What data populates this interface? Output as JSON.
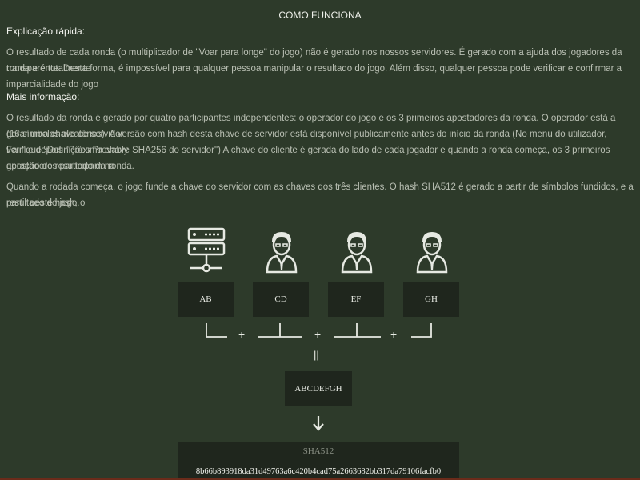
{
  "header": {
    "title": "COMO FUNCIONA"
  },
  "quick": {
    "heading": "Explicação rápida:",
    "line1": "O resultado de cada ronda (o multiplicador de \"Voar para longe\" do jogo) não é gerado nos nossos servidores. É gerado com a ajuda dos jogadores da ronda e é totalmente",
    "line2": "transparente. Desta forma, é impossível para qualquer pessoa manipular o resultado do jogo. Além disso, qualquer pessoa pode verificar e confirmar a imparcialidade do jogo"
  },
  "more": {
    "heading": "Mais informação:",
    "line1": "O resultado da ronda é gerado por quatro participantes independentes: o operador do jogo e os 3 primeiros apostadores da ronda. O operador está a gerar uma chave de servidor",
    "line2": "(16 símbolos aleatórios). A versão com hash desta chave de servidor está disponível publicamente antes do início da ronda (No menu do utilizador, verifique \"Definições Provably",
    "line3": "Fair\" e depois \"Próxima chave SHA256 do servidor\") A chave do cliente é gerada do lado de cada jogador e quando a ronda começa, os 3 primeiros apostadores participam na",
    "line4": "geração do resultado da ronda.",
    "line5": "Quando a rodada começa, o jogo funde a chave do servidor com as chaves dos três clientes. O hash SHA512 é gerado a partir de símbolos fundidos, e a partir deste hash, o",
    "line6": "resultado do jogo."
  },
  "diagram": {
    "icons": [
      "server-icon",
      "player-icon",
      "player-icon",
      "player-icon"
    ],
    "keys": [
      "AB",
      "CD",
      "EF",
      "GH"
    ],
    "plus": "+",
    "equals": "||",
    "combined": "ABCDEFGH",
    "arrow": "↓",
    "sha_label": "SHA512",
    "sha_hash": "8b66b893918da31d49763a6c420b4cad75a2663682bb317da79106facfb0"
  },
  "colors": {
    "background": "#2d3a2a",
    "panel": "#1f261d",
    "icon": "#e6e9e2",
    "bottom_accent": "#6b2b1a"
  }
}
